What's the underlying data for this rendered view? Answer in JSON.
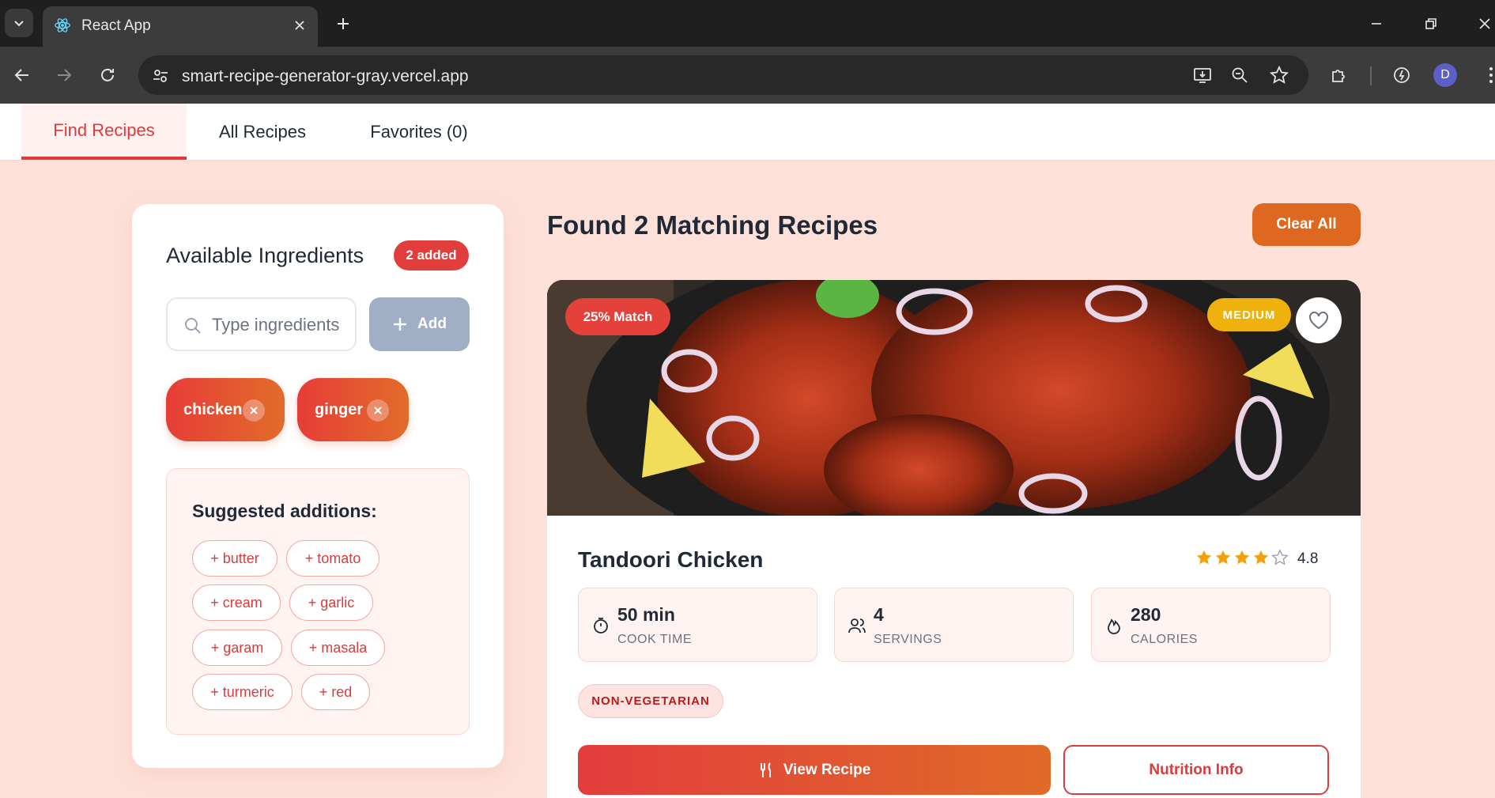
{
  "browser": {
    "tab_title": "React App",
    "url": "smart-recipe-generator-gray.vercel.app",
    "avatar_letter": "D"
  },
  "app_nav": {
    "tabs": [
      {
        "label": "Find Recipes",
        "active": true
      },
      {
        "label": "All Recipes",
        "active": false
      },
      {
        "label": "Favorites (0)",
        "active": false
      }
    ]
  },
  "ingredients_panel": {
    "title": "Available Ingredients",
    "count_badge": "2 added",
    "search_placeholder": "Type ingredients",
    "add_label": "Add",
    "chips": [
      "chicken",
      "ginger"
    ],
    "suggestions_title": "Suggested additions:",
    "suggestions": [
      "+ butter",
      "+ tomato",
      "+ cream",
      "+ garlic",
      "+ garam",
      "+ masala",
      "+ turmeric",
      "+ red"
    ]
  },
  "results": {
    "title": "Found 2 Matching Recipes",
    "clear_label": "Clear All"
  },
  "recipe_card": {
    "match_badge": "25% Match",
    "difficulty": "MEDIUM",
    "title": "Tandoori Chicken",
    "rating": "4.8",
    "rating_value": 4.8,
    "stats": [
      {
        "icon": "timer-icon",
        "value": "50 min",
        "label": "COOK TIME"
      },
      {
        "icon": "people-icon",
        "value": "4",
        "label": "SERVINGS"
      },
      {
        "icon": "flame-icon",
        "value": "280",
        "label": "CALORIES"
      }
    ],
    "diet_tag": "NON-VEGETARIAN",
    "view_label": "View Recipe",
    "nutrition_label": "Nutrition Info"
  },
  "colors": {
    "accent_red": "#e23d3d",
    "accent_orange": "#df6820",
    "difficulty_yellow": "#efb10d",
    "star": "#f59e0b"
  }
}
